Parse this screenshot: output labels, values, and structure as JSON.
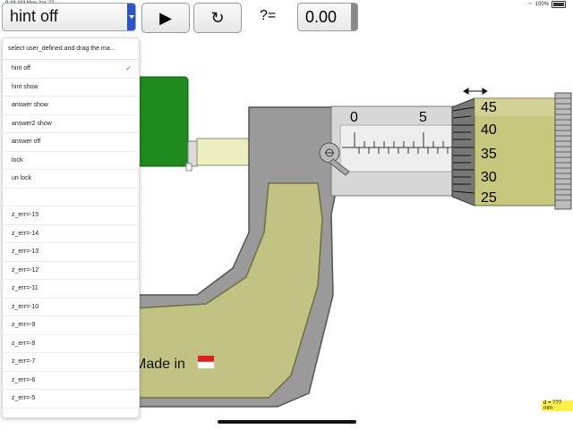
{
  "status": {
    "time": "9:48 AM",
    "date": "Mon Apr 22",
    "battery": "100%"
  },
  "toolbar": {
    "mode_value": "hint off",
    "play_icon": "play-icon",
    "reload_icon": "reload-icon",
    "question": "?=",
    "answer_value": "0.00"
  },
  "menu": {
    "header": "select user_defined and drag the ma...",
    "items": [
      {
        "label": "hint off",
        "checked": true
      },
      {
        "label": "hint show"
      },
      {
        "label": "answer show"
      },
      {
        "label": "answer2 show"
      },
      {
        "label": "answer off"
      },
      {
        "label": "lock"
      },
      {
        "label": "un lock"
      },
      {
        "label": ""
      },
      {
        "label": "z_err=-15"
      },
      {
        "label": "z_err=-14"
      },
      {
        "label": "z_err=-13"
      },
      {
        "label": "z_err=-12"
      },
      {
        "label": "z_err=-11"
      },
      {
        "label": "z_err=-10"
      },
      {
        "label": "z_err=-9"
      },
      {
        "label": "z_err=-8"
      },
      {
        "label": "z_err=-7"
      },
      {
        "label": "z_err=-6"
      },
      {
        "label": "z_err=-5"
      }
    ]
  },
  "micrometer": {
    "sleeve_labels": [
      "0",
      "5"
    ],
    "thimble_labels": [
      "45",
      "40",
      "35",
      "30",
      "25"
    ],
    "made_in": "Made in",
    "reading": "d = ??? mm"
  }
}
